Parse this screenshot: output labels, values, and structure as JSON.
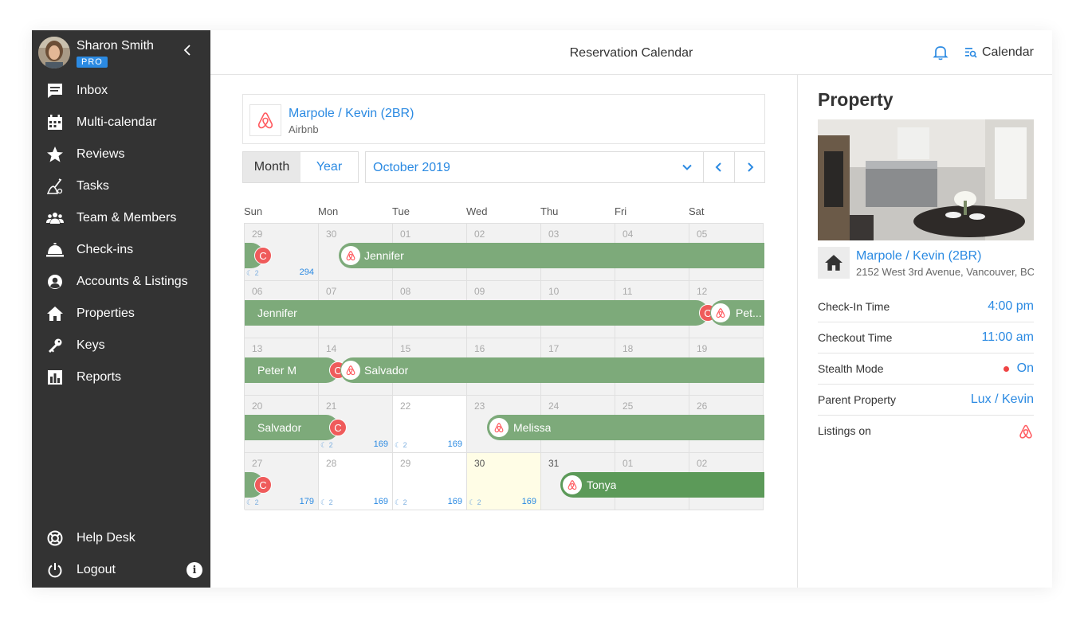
{
  "user": {
    "name": "Sharon Smith",
    "badge": "PRO"
  },
  "nav": [
    {
      "label": "Inbox",
      "icon": "inbox-icon"
    },
    {
      "label": "Multi-calendar",
      "icon": "calendar-icon"
    },
    {
      "label": "Reviews",
      "icon": "star-icon"
    },
    {
      "label": "Tasks",
      "icon": "broom-icon"
    },
    {
      "label": "Team & Members",
      "icon": "team-icon"
    },
    {
      "label": "Check-ins",
      "icon": "bell-service-icon"
    },
    {
      "label": "Accounts & Listings",
      "icon": "account-icon"
    },
    {
      "label": "Properties",
      "icon": "home-icon"
    },
    {
      "label": "Keys",
      "icon": "key-icon"
    },
    {
      "label": "Reports",
      "icon": "reports-icon"
    }
  ],
  "nav_bottom": [
    {
      "label": "Help Desk",
      "icon": "lifebuoy-icon"
    },
    {
      "label": "Logout",
      "icon": "power-icon"
    }
  ],
  "header": {
    "title": "Reservation Calendar",
    "calendar_link": "Calendar"
  },
  "listing": {
    "name": "Marpole / Kevin (2BR)",
    "source": "Airbnb"
  },
  "view_toggle": {
    "month": "Month",
    "year": "Year"
  },
  "month_select": {
    "value": "October 2019"
  },
  "weekdays": [
    "Sun",
    "Mon",
    "Tue",
    "Wed",
    "Thu",
    "Fri",
    "Sat"
  ],
  "weeks": [
    [
      {
        "day": "29",
        "nights": "2",
        "price": "294"
      },
      {
        "day": "30"
      },
      {
        "day": "01"
      },
      {
        "day": "02"
      },
      {
        "day": "03"
      },
      {
        "day": "04"
      },
      {
        "day": "05"
      }
    ],
    [
      {
        "day": "06"
      },
      {
        "day": "07"
      },
      {
        "day": "08"
      },
      {
        "day": "09"
      },
      {
        "day": "10"
      },
      {
        "day": "11"
      },
      {
        "day": "12"
      }
    ],
    [
      {
        "day": "13"
      },
      {
        "day": "14"
      },
      {
        "day": "15"
      },
      {
        "day": "16"
      },
      {
        "day": "17"
      },
      {
        "day": "18"
      },
      {
        "day": "19"
      }
    ],
    [
      {
        "day": "20"
      },
      {
        "day": "21",
        "nights": "2",
        "price": "169"
      },
      {
        "day": "22",
        "nights": "2",
        "price": "169"
      },
      {
        "day": "23"
      },
      {
        "day": "24"
      },
      {
        "day": "25"
      },
      {
        "day": "26"
      }
    ],
    [
      {
        "day": "27",
        "nights": "2",
        "price": "179"
      },
      {
        "day": "28",
        "nights": "2",
        "price": "169"
      },
      {
        "day": "29",
        "nights": "2",
        "price": "169"
      },
      {
        "day": "30",
        "nights": "2",
        "price": "169"
      },
      {
        "day": "31"
      },
      {
        "day": "01"
      },
      {
        "day": "02"
      }
    ]
  ],
  "bookings": {
    "jennifer": "Jennifer",
    "jennifer2": "Jennifer",
    "peter_short": "Pet...",
    "peter": "Peter M",
    "salvador": "Salvador",
    "salvador2": "Salvador",
    "melissa": "Melissa",
    "tonya": "Tonya",
    "cancel_badge": "C"
  },
  "property": {
    "heading": "Property",
    "name": "Marpole / Kevin (2BR)",
    "address": "2152 West 3rd Avenue, Vancouver, BC",
    "rows": [
      {
        "key": "Check-In Time",
        "value": "4:00 pm"
      },
      {
        "key": "Checkout Time",
        "value": "11:00 am"
      },
      {
        "key": "Stealth Mode",
        "value": "On"
      },
      {
        "key": "Parent Property",
        "value": "Lux / Kevin"
      },
      {
        "key": "Listings on",
        "value": ""
      }
    ]
  },
  "colors": {
    "accent": "#2b8ae2",
    "sidebar": "#333333",
    "booking": "#7daa7a",
    "booking_dark": "#5c9a59",
    "cancel": "#ef5b5b",
    "airbnb": "#ff5a5f"
  }
}
